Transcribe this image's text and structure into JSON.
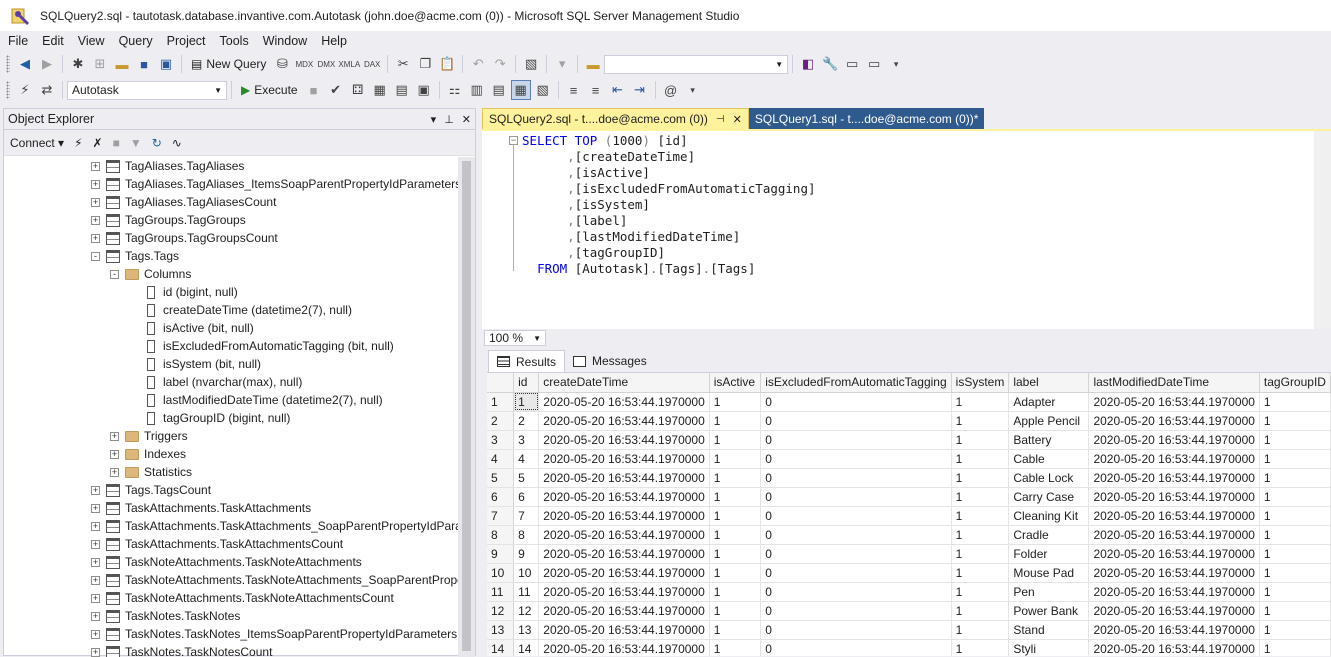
{
  "window": {
    "title": "SQLQuery2.sql - tautotask.database.invantive.com.Autotask (john.doe@acme.com (0)) - Microsoft SQL Server Management Studio"
  },
  "menu": [
    "File",
    "Edit",
    "View",
    "Query",
    "Project",
    "Tools",
    "Window",
    "Help"
  ],
  "toolbar": {
    "new_query_label": "New Query",
    "execute_label": "Execute",
    "database": "Autotask",
    "search_value": ""
  },
  "object_explorer": {
    "title": "Object Explorer",
    "connect_label": "Connect",
    "tree": [
      {
        "label": "TagAliases.TagAliases",
        "level": 0,
        "type": "table",
        "expander": "+"
      },
      {
        "label": "TagAliases.TagAliases_ItemsSoapParentPropertyIdParameters",
        "level": 0,
        "type": "table",
        "expander": "+"
      },
      {
        "label": "TagAliases.TagAliasesCount",
        "level": 0,
        "type": "table",
        "expander": "+"
      },
      {
        "label": "TagGroups.TagGroups",
        "level": 0,
        "type": "table",
        "expander": "+"
      },
      {
        "label": "TagGroups.TagGroupsCount",
        "level": 0,
        "type": "table",
        "expander": "+"
      },
      {
        "label": "Tags.Tags",
        "level": 0,
        "type": "table",
        "expander": "-"
      },
      {
        "label": "Columns",
        "level": 1,
        "type": "folder",
        "expander": "-"
      },
      {
        "label": "id (bigint, null)",
        "level": 2,
        "type": "column",
        "expander": ""
      },
      {
        "label": "createDateTime (datetime2(7), null)",
        "level": 2,
        "type": "column",
        "expander": ""
      },
      {
        "label": "isActive (bit, null)",
        "level": 2,
        "type": "column",
        "expander": ""
      },
      {
        "label": "isExcludedFromAutomaticTagging (bit, null)",
        "level": 2,
        "type": "column",
        "expander": ""
      },
      {
        "label": "isSystem (bit, null)",
        "level": 2,
        "type": "column",
        "expander": ""
      },
      {
        "label": "label (nvarchar(max), null)",
        "level": 2,
        "type": "column",
        "expander": ""
      },
      {
        "label": "lastModifiedDateTime (datetime2(7), null)",
        "level": 2,
        "type": "column",
        "expander": ""
      },
      {
        "label": "tagGroupID (bigint, null)",
        "level": 2,
        "type": "column",
        "expander": ""
      },
      {
        "label": "Triggers",
        "level": 1,
        "type": "folder",
        "expander": "+"
      },
      {
        "label": "Indexes",
        "level": 1,
        "type": "folder",
        "expander": "+"
      },
      {
        "label": "Statistics",
        "level": 1,
        "type": "folder",
        "expander": "+"
      },
      {
        "label": "Tags.TagsCount",
        "level": 0,
        "type": "table",
        "expander": "+"
      },
      {
        "label": "TaskAttachments.TaskAttachments",
        "level": 0,
        "type": "table",
        "expander": "+"
      },
      {
        "label": "TaskAttachments.TaskAttachments_SoapParentPropertyIdParameters",
        "level": 0,
        "type": "table",
        "expander": "+"
      },
      {
        "label": "TaskAttachments.TaskAttachmentsCount",
        "level": 0,
        "type": "table",
        "expander": "+"
      },
      {
        "label": "TaskNoteAttachments.TaskNoteAttachments",
        "level": 0,
        "type": "table",
        "expander": "+"
      },
      {
        "label": "TaskNoteAttachments.TaskNoteAttachments_SoapParentPropertyIdParameters",
        "level": 0,
        "type": "table",
        "expander": "+"
      },
      {
        "label": "TaskNoteAttachments.TaskNoteAttachmentsCount",
        "level": 0,
        "type": "table",
        "expander": "+"
      },
      {
        "label": "TaskNotes.TaskNotes",
        "level": 0,
        "type": "table",
        "expander": "+"
      },
      {
        "label": "TaskNotes.TaskNotes_ItemsSoapParentPropertyIdParameters",
        "level": 0,
        "type": "table",
        "expander": "+"
      },
      {
        "label": "TaskNotes.TaskNotesCount",
        "level": 0,
        "type": "table",
        "expander": "+"
      }
    ]
  },
  "tabs": [
    {
      "label": "SQLQuery2.sql - t....doe@acme.com (0))",
      "active": true
    },
    {
      "label": "SQLQuery1.sql - t....doe@acme.com (0))*",
      "active": false
    }
  ],
  "editor": {
    "lines": [
      {
        "indent": "",
        "parts": [
          [
            "kw",
            "SELECT TOP "
          ],
          [
            "gr",
            "("
          ],
          [
            "",
            "1000"
          ],
          [
            "gr",
            ")"
          ],
          [
            "",
            " [id]"
          ]
        ]
      },
      {
        "indent": "      ",
        "parts": [
          [
            "gr",
            ","
          ],
          [
            "",
            "[createDateTime]"
          ]
        ]
      },
      {
        "indent": "      ",
        "parts": [
          [
            "gr",
            ","
          ],
          [
            "",
            "[isActive]"
          ]
        ]
      },
      {
        "indent": "      ",
        "parts": [
          [
            "gr",
            ","
          ],
          [
            "",
            "[isExcludedFromAutomaticTagging]"
          ]
        ]
      },
      {
        "indent": "      ",
        "parts": [
          [
            "gr",
            ","
          ],
          [
            "",
            "[isSystem]"
          ]
        ]
      },
      {
        "indent": "      ",
        "parts": [
          [
            "gr",
            ","
          ],
          [
            "",
            "[label]"
          ]
        ]
      },
      {
        "indent": "      ",
        "parts": [
          [
            "gr",
            ","
          ],
          [
            "",
            "[lastModifiedDateTime]"
          ]
        ]
      },
      {
        "indent": "      ",
        "parts": [
          [
            "gr",
            ","
          ],
          [
            "",
            "[tagGroupID]"
          ]
        ]
      },
      {
        "indent": "  ",
        "parts": [
          [
            "kw",
            "FROM "
          ],
          [
            "",
            "[Autotask]"
          ],
          [
            "gr",
            "."
          ],
          [
            "",
            "[Tags]"
          ],
          [
            "gr",
            "."
          ],
          [
            "",
            "[Tags]"
          ]
        ]
      }
    ]
  },
  "zoom": "100 %",
  "results_tabs": [
    "Results",
    "Messages"
  ],
  "results": {
    "columns": [
      "id",
      "createDateTime",
      "isActive",
      "isExcludedFromAutomaticTagging",
      "isSystem",
      "label",
      "lastModifiedDateTime",
      "tagGroupID"
    ],
    "rows": [
      [
        "1",
        "1",
        "2020-05-20 16:53:44.1970000",
        "1",
        "0",
        "1",
        "Adapter",
        "2020-05-20 16:53:44.1970000",
        "1"
      ],
      [
        "2",
        "2",
        "2020-05-20 16:53:44.1970000",
        "1",
        "0",
        "1",
        "Apple Pencil",
        "2020-05-20 16:53:44.1970000",
        "1"
      ],
      [
        "3",
        "3",
        "2020-05-20 16:53:44.1970000",
        "1",
        "0",
        "1",
        "Battery",
        "2020-05-20 16:53:44.1970000",
        "1"
      ],
      [
        "4",
        "4",
        "2020-05-20 16:53:44.1970000",
        "1",
        "0",
        "1",
        "Cable",
        "2020-05-20 16:53:44.1970000",
        "1"
      ],
      [
        "5",
        "5",
        "2020-05-20 16:53:44.1970000",
        "1",
        "0",
        "1",
        "Cable Lock",
        "2020-05-20 16:53:44.1970000",
        "1"
      ],
      [
        "6",
        "6",
        "2020-05-20 16:53:44.1970000",
        "1",
        "0",
        "1",
        "Carry Case",
        "2020-05-20 16:53:44.1970000",
        "1"
      ],
      [
        "7",
        "7",
        "2020-05-20 16:53:44.1970000",
        "1",
        "0",
        "1",
        "Cleaning Kit",
        "2020-05-20 16:53:44.1970000",
        "1"
      ],
      [
        "8",
        "8",
        "2020-05-20 16:53:44.1970000",
        "1",
        "0",
        "1",
        "Cradle",
        "2020-05-20 16:53:44.1970000",
        "1"
      ],
      [
        "9",
        "9",
        "2020-05-20 16:53:44.1970000",
        "1",
        "0",
        "1",
        "Folder",
        "2020-05-20 16:53:44.1970000",
        "1"
      ],
      [
        "10",
        "10",
        "2020-05-20 16:53:44.1970000",
        "1",
        "0",
        "1",
        "Mouse Pad",
        "2020-05-20 16:53:44.1970000",
        "1"
      ],
      [
        "11",
        "11",
        "2020-05-20 16:53:44.1970000",
        "1",
        "0",
        "1",
        "Pen",
        "2020-05-20 16:53:44.1970000",
        "1"
      ],
      [
        "12",
        "12",
        "2020-05-20 16:53:44.1970000",
        "1",
        "0",
        "1",
        "Power Bank",
        "2020-05-20 16:53:44.1970000",
        "1"
      ],
      [
        "13",
        "13",
        "2020-05-20 16:53:44.1970000",
        "1",
        "0",
        "1",
        "Stand",
        "2020-05-20 16:53:44.1970000",
        "1"
      ],
      [
        "14",
        "14",
        "2020-05-20 16:53:44.1970000",
        "1",
        "0",
        "1",
        "Styli",
        "2020-05-20 16:53:44.1970000",
        "1"
      ]
    ]
  }
}
